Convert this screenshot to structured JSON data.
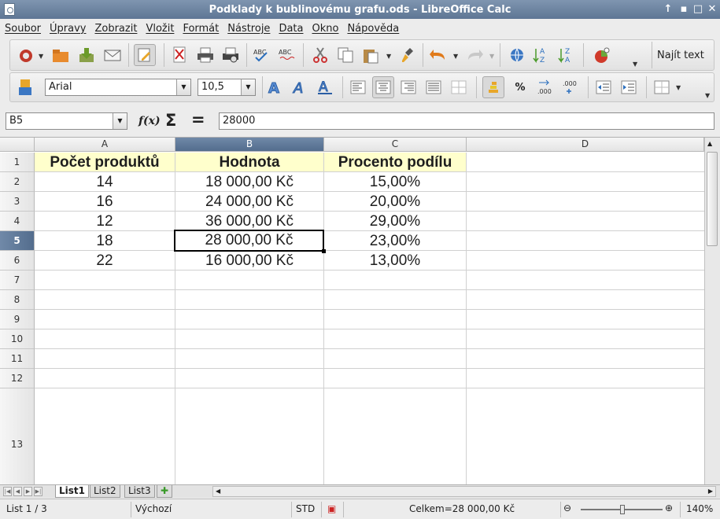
{
  "window": {
    "title": "Podklady k bublinovému grafu.ods - LibreOffice Calc"
  },
  "menu": [
    "Soubor",
    "Úpravy",
    "Zobrazit",
    "Vložit",
    "Formát",
    "Nástroje",
    "Data",
    "Okno",
    "Nápověda"
  ],
  "toolbar": {
    "find_label": "Najít text"
  },
  "format": {
    "font_name": "Arial",
    "font_size": "10,5"
  },
  "formula": {
    "cell_ref": "B5",
    "content": "28000",
    "fx": "f(x)",
    "sum": "Σ",
    "equals": "="
  },
  "grid": {
    "columns": [
      "A",
      "B",
      "C",
      "D"
    ],
    "selected_column": "B",
    "selected_row": 5,
    "rows": [
      "1",
      "2",
      "3",
      "4",
      "5",
      "6",
      "7",
      "8",
      "9",
      "10",
      "11",
      "12",
      "13"
    ],
    "header": [
      "Počet produktů",
      "Hodnota",
      "Procento podílu"
    ],
    "data": [
      [
        "14",
        "18 000,00 Kč",
        "15,00%"
      ],
      [
        "16",
        "24 000,00 Kč",
        "20,00%"
      ],
      [
        "12",
        "36 000,00 Kč",
        "29,00%"
      ],
      [
        "18",
        "28 000,00 Kč",
        "23,00%"
      ],
      [
        "22",
        "16 000,00 Kč",
        "13,00%"
      ]
    ]
  },
  "sheets": [
    "List1",
    "List2",
    "List3"
  ],
  "active_sheet": "List1",
  "status": {
    "sheet": "List 1 / 3",
    "style": "Výchozí",
    "mode": "STD",
    "sum": "Celkem=28 000,00 Kč",
    "zoom": "140%"
  },
  "colors": {
    "title_bar": "#6a82a0",
    "header_fill": "#ffffcc",
    "selection": "#5d7898"
  }
}
